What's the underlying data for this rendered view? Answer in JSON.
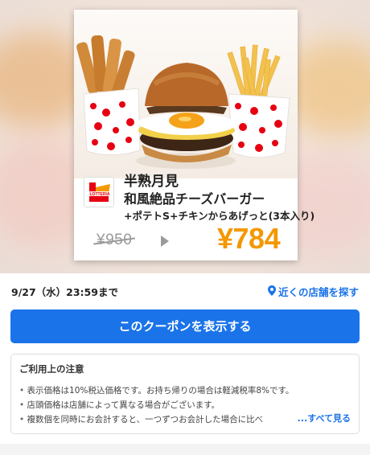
{
  "coupon": {
    "brand": "LOTTERIA",
    "name_line1": "半熟月見",
    "name_line2": "和風絶品チーズバーガー",
    "name_line3": "+ポテトS+チキンからあげっと(3本入り)",
    "old_price": "¥950",
    "new_price": "¥784"
  },
  "info": {
    "expiry": "9/27（水）23:59まで",
    "store_link": "近くの店舗を探す"
  },
  "show_button_label": "このクーポンを表示する",
  "notes": {
    "title": "ご利用上の注意",
    "items": [
      "表示価格は10%税込価格です。お持ち帰りの場合は軽減税率8%です。",
      "店頭価格は店舗によって異なる場合がございます。",
      "複数個を同時にお会計すると、一つずつお会計した場合に比べ"
    ],
    "see_all": "...すべて見る"
  },
  "colors": {
    "accent": "#1a73e8",
    "price": "#f39800",
    "brand_red": "#e60012"
  }
}
